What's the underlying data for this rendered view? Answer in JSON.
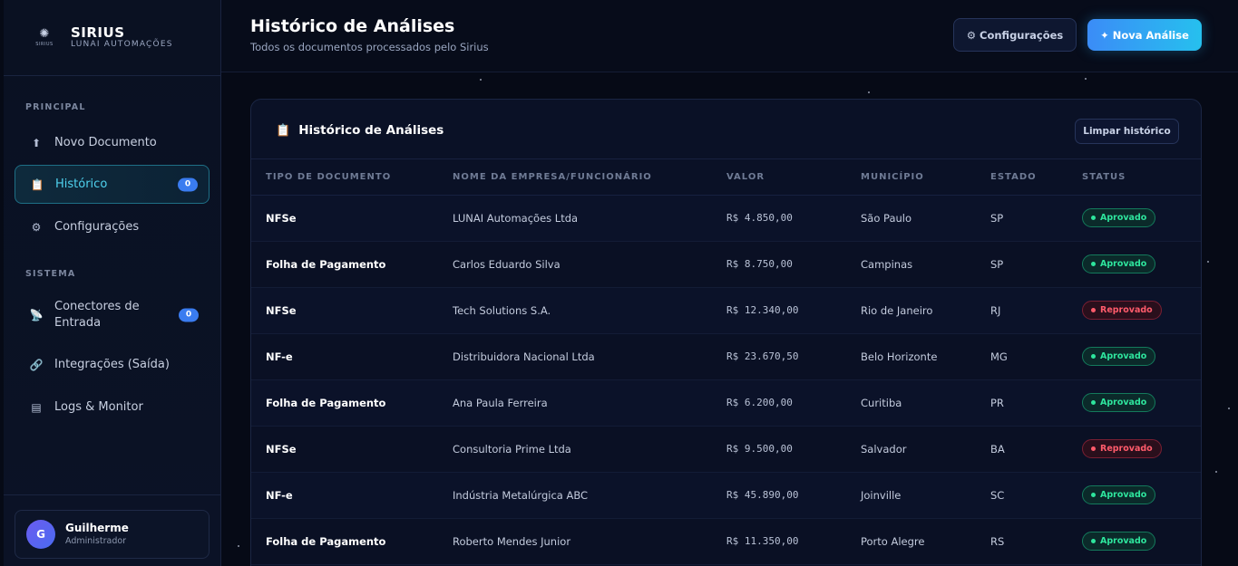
{
  "brand": {
    "logo_glyph": "✺",
    "logo_caption": "SIRIUS",
    "name": "SIRIUS",
    "subtitle": "LUNAI AUTOMAÇÕES"
  },
  "sidebar": {
    "section_principal": "PRINCIPAL",
    "section_sistema": "SISTEMA",
    "items": [
      {
        "icon": "upload-arrow-icon",
        "glyph": "⬆",
        "label": "Novo Documento"
      },
      {
        "icon": "clipboard-icon",
        "glyph": "📋",
        "label": "Histórico",
        "badge": "0",
        "active": true
      },
      {
        "icon": "gear-icon",
        "glyph": "⚙",
        "label": "Configurações"
      },
      {
        "icon": "satellite-icon",
        "glyph": "📡",
        "label": "Conectores de Entrada",
        "badge": "0"
      },
      {
        "icon": "link-icon",
        "glyph": "🔗",
        "label": "Integrações (Saída)"
      },
      {
        "icon": "log-icon",
        "glyph": "▤",
        "label": "Logs & Monitor"
      }
    ],
    "user": {
      "initial": "G",
      "name": "Guilherme",
      "role": "Administrador"
    }
  },
  "header": {
    "title": "Histórico de Análises",
    "subtitle": "Todos os documentos processados pelo Sirius",
    "config_label": "Configurações",
    "config_glyph": "⚙",
    "new_label": "Nova Análise",
    "new_glyph": "✦"
  },
  "card": {
    "title": "Histórico de Análises",
    "title_glyph": "📋",
    "clear_label": "Limpar histórico",
    "columns": [
      "TIPO DE DOCUMENTO",
      "NOME DA EMPRESA/FUNCIONÁRIO",
      "VALOR",
      "MUNICÍPIO",
      "ESTADO",
      "STATUS"
    ],
    "rows": [
      {
        "tipo": "NFSe",
        "nome": "LUNAI Automações Ltda",
        "valor": "R$ 4.850,00",
        "municipio": "São Paulo",
        "estado": "SP",
        "status": "Aprovado",
        "ok": true
      },
      {
        "tipo": "Folha de Pagamento",
        "nome": "Carlos Eduardo Silva",
        "valor": "R$ 8.750,00",
        "municipio": "Campinas",
        "estado": "SP",
        "status": "Aprovado",
        "ok": true
      },
      {
        "tipo": "NFSe",
        "nome": "Tech Solutions S.A.",
        "valor": "R$ 12.340,00",
        "municipio": "Rio de Janeiro",
        "estado": "RJ",
        "status": "Reprovado",
        "ok": false
      },
      {
        "tipo": "NF-e",
        "nome": "Distribuidora Nacional Ltda",
        "valor": "R$ 23.670,50",
        "municipio": "Belo Horizonte",
        "estado": "MG",
        "status": "Aprovado",
        "ok": true
      },
      {
        "tipo": "Folha de Pagamento",
        "nome": "Ana Paula Ferreira",
        "valor": "R$ 6.200,00",
        "municipio": "Curitiba",
        "estado": "PR",
        "status": "Aprovado",
        "ok": true
      },
      {
        "tipo": "NFSe",
        "nome": "Consultoria Prime Ltda",
        "valor": "R$ 9.500,00",
        "municipio": "Salvador",
        "estado": "BA",
        "status": "Reprovado",
        "ok": false
      },
      {
        "tipo": "NF-e",
        "nome": "Indústria Metalúrgica ABC",
        "valor": "R$ 45.890,00",
        "municipio": "Joinville",
        "estado": "SC",
        "status": "Aprovado",
        "ok": true
      },
      {
        "tipo": "Folha de Pagamento",
        "nome": "Roberto Mendes Junior",
        "valor": "R$ 11.350,00",
        "municipio": "Porto Alegre",
        "estado": "RS",
        "status": "Aprovado",
        "ok": true
      }
    ]
  },
  "colors": {
    "accent": "#26c0ee",
    "approved": "#2ee59d",
    "rejected": "#ff5b6b",
    "badge": "#3a7cf0"
  }
}
